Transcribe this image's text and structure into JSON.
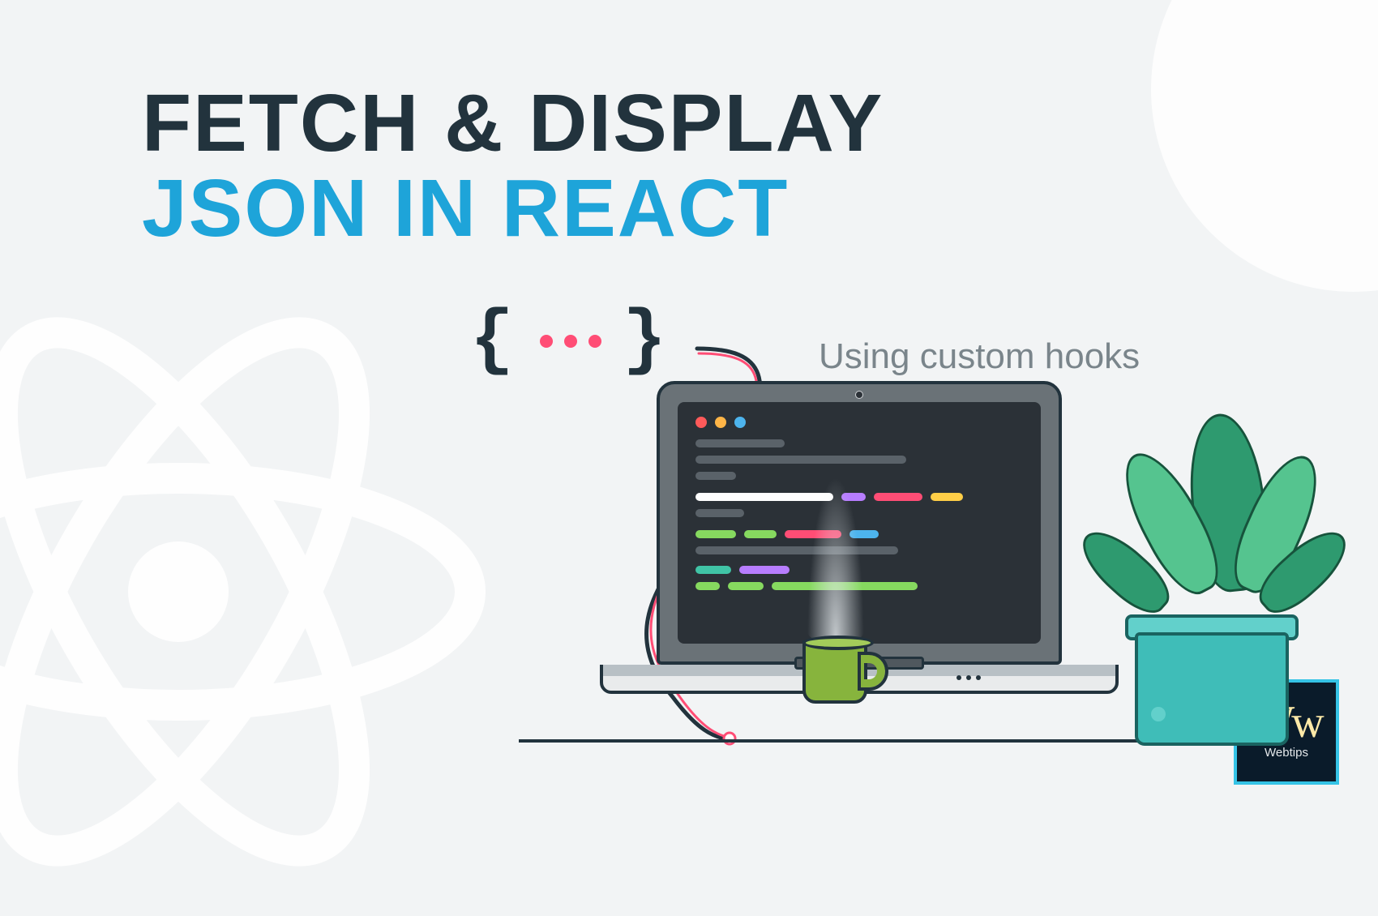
{
  "heading": {
    "line1": "FETCH & DISPLAY",
    "line2": "JSON IN REACT"
  },
  "subtitle": "Using custom hooks",
  "braces": {
    "open": "{",
    "close": "}"
  },
  "logo": {
    "mark": "Ww",
    "label": "Webtips"
  },
  "colors": {
    "dark": "#22333d",
    "accent": "#1ea4d9",
    "pink": "#ff4d75"
  }
}
